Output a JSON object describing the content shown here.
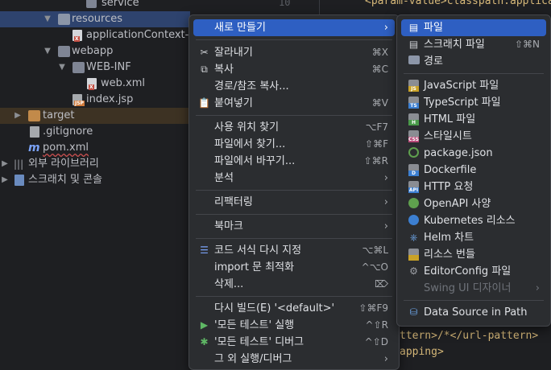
{
  "tree": {
    "items": [
      {
        "label": "service"
      },
      {
        "label": "resources"
      },
      {
        "label": "applicationContext-w"
      },
      {
        "label": "webapp"
      },
      {
        "label": "WEB-INF"
      },
      {
        "label": "web.xml"
      },
      {
        "label": "index.jsp"
      },
      {
        "label": "target"
      },
      {
        "label": ".gitignore"
      },
      {
        "label": "pom.xml"
      },
      {
        "label": "외부 라이브러리"
      },
      {
        "label": "스크래치 및 콘솔"
      }
    ],
    "file_tag_xml": "X",
    "file_tag_jsp": "JSP",
    "maven_icon": "m"
  },
  "editor": {
    "line_number": "10",
    "line1": "<param-value>classpath:applica",
    "line2": "ttern>/*</url-pattern>",
    "line3": "apping>"
  },
  "context_menu": {
    "items": [
      {
        "label": "새로 만들기",
        "icon": "",
        "shortcut": ""
      },
      {
        "label": "잘라내기",
        "icon": "scissors-icon",
        "shortcut": "⌘X"
      },
      {
        "label": "복사",
        "icon": "copy-icon",
        "shortcut": "⌘C"
      },
      {
        "label": "경로/참조 복사...",
        "icon": "",
        "shortcut": ""
      },
      {
        "label": "붙여넣기",
        "icon": "clipboard-icon",
        "shortcut": "⌘V"
      },
      {
        "label": "사용 위치 찾기",
        "icon": "",
        "shortcut": "⌥F7"
      },
      {
        "label": "파일에서 찾기...",
        "icon": "",
        "shortcut": "⇧⌘F"
      },
      {
        "label": "파일에서 바꾸기...",
        "icon": "",
        "shortcut": "⇧⌘R"
      },
      {
        "label": "분석",
        "icon": "",
        "shortcut": ""
      },
      {
        "label": "리팩터링",
        "icon": "",
        "shortcut": ""
      },
      {
        "label": "북마크",
        "icon": "",
        "shortcut": ""
      },
      {
        "label": "코드 서식 다시 지정",
        "icon": "format-icon",
        "shortcut": "⌥⌘L"
      },
      {
        "label": "import 문 최적화",
        "icon": "",
        "shortcut": "^⌥O"
      },
      {
        "label": "삭제...",
        "icon": "",
        "shortcut": "⌦"
      },
      {
        "label": "다시 빌드(E) '<default>'",
        "icon": "",
        "shortcut": "⇧⌘F9"
      },
      {
        "label": "'모든 테스트' 실행",
        "icon": "run-icon",
        "shortcut": "^⇧R"
      },
      {
        "label": "'모든 테스트' 디버그",
        "icon": "debug-icon",
        "shortcut": "^⇧D"
      },
      {
        "label": "그 외 실행/디버그",
        "icon": "",
        "shortcut": ""
      }
    ]
  },
  "submenu": {
    "items": [
      {
        "label": "파일",
        "icon": "file-icon",
        "shortcut": ""
      },
      {
        "label": "스크래치 파일",
        "icon": "scratch-file-icon",
        "shortcut": "⇧⌘N"
      },
      {
        "label": "경로",
        "icon": "folder-icon",
        "shortcut": ""
      },
      {
        "label": "JavaScript 파일",
        "icon": "javascript-file-icon",
        "tag": "JS",
        "shortcut": ""
      },
      {
        "label": "TypeScript 파일",
        "icon": "typescript-file-icon",
        "tag": "TS",
        "shortcut": ""
      },
      {
        "label": "HTML 파일",
        "icon": "html-file-icon",
        "tag": "H",
        "shortcut": ""
      },
      {
        "label": "스타일시트",
        "icon": "stylesheet-icon",
        "tag": "CSS",
        "shortcut": ""
      },
      {
        "label": "package.json",
        "icon": "nodejs-icon",
        "shortcut": ""
      },
      {
        "label": "Dockerfile",
        "icon": "dockerfile-icon",
        "tag": "D",
        "shortcut": ""
      },
      {
        "label": "HTTP 요청",
        "icon": "http-request-icon",
        "tag": "API",
        "shortcut": ""
      },
      {
        "label": "OpenAPI 사양",
        "icon": "openapi-icon",
        "shortcut": ""
      },
      {
        "label": "Kubernetes 리소스",
        "icon": "kubernetes-icon",
        "shortcut": ""
      },
      {
        "label": "Helm 차트",
        "icon": "helm-icon",
        "shortcut": ""
      },
      {
        "label": "리소스 번들",
        "icon": "resource-bundle-icon",
        "shortcut": ""
      },
      {
        "label": "EditorConfig 파일",
        "icon": "editorconfig-icon",
        "shortcut": ""
      },
      {
        "label": "Swing UI 디자이너",
        "icon": "",
        "shortcut": ""
      },
      {
        "label": "Data Source in Path",
        "icon": "database-icon",
        "shortcut": ""
      }
    ]
  },
  "colors": {
    "accent": "#2e5fc2",
    "menu_bg": "#2b2d30",
    "tree_selection": "#2e436e",
    "excluded_folder": "#3d3223"
  }
}
